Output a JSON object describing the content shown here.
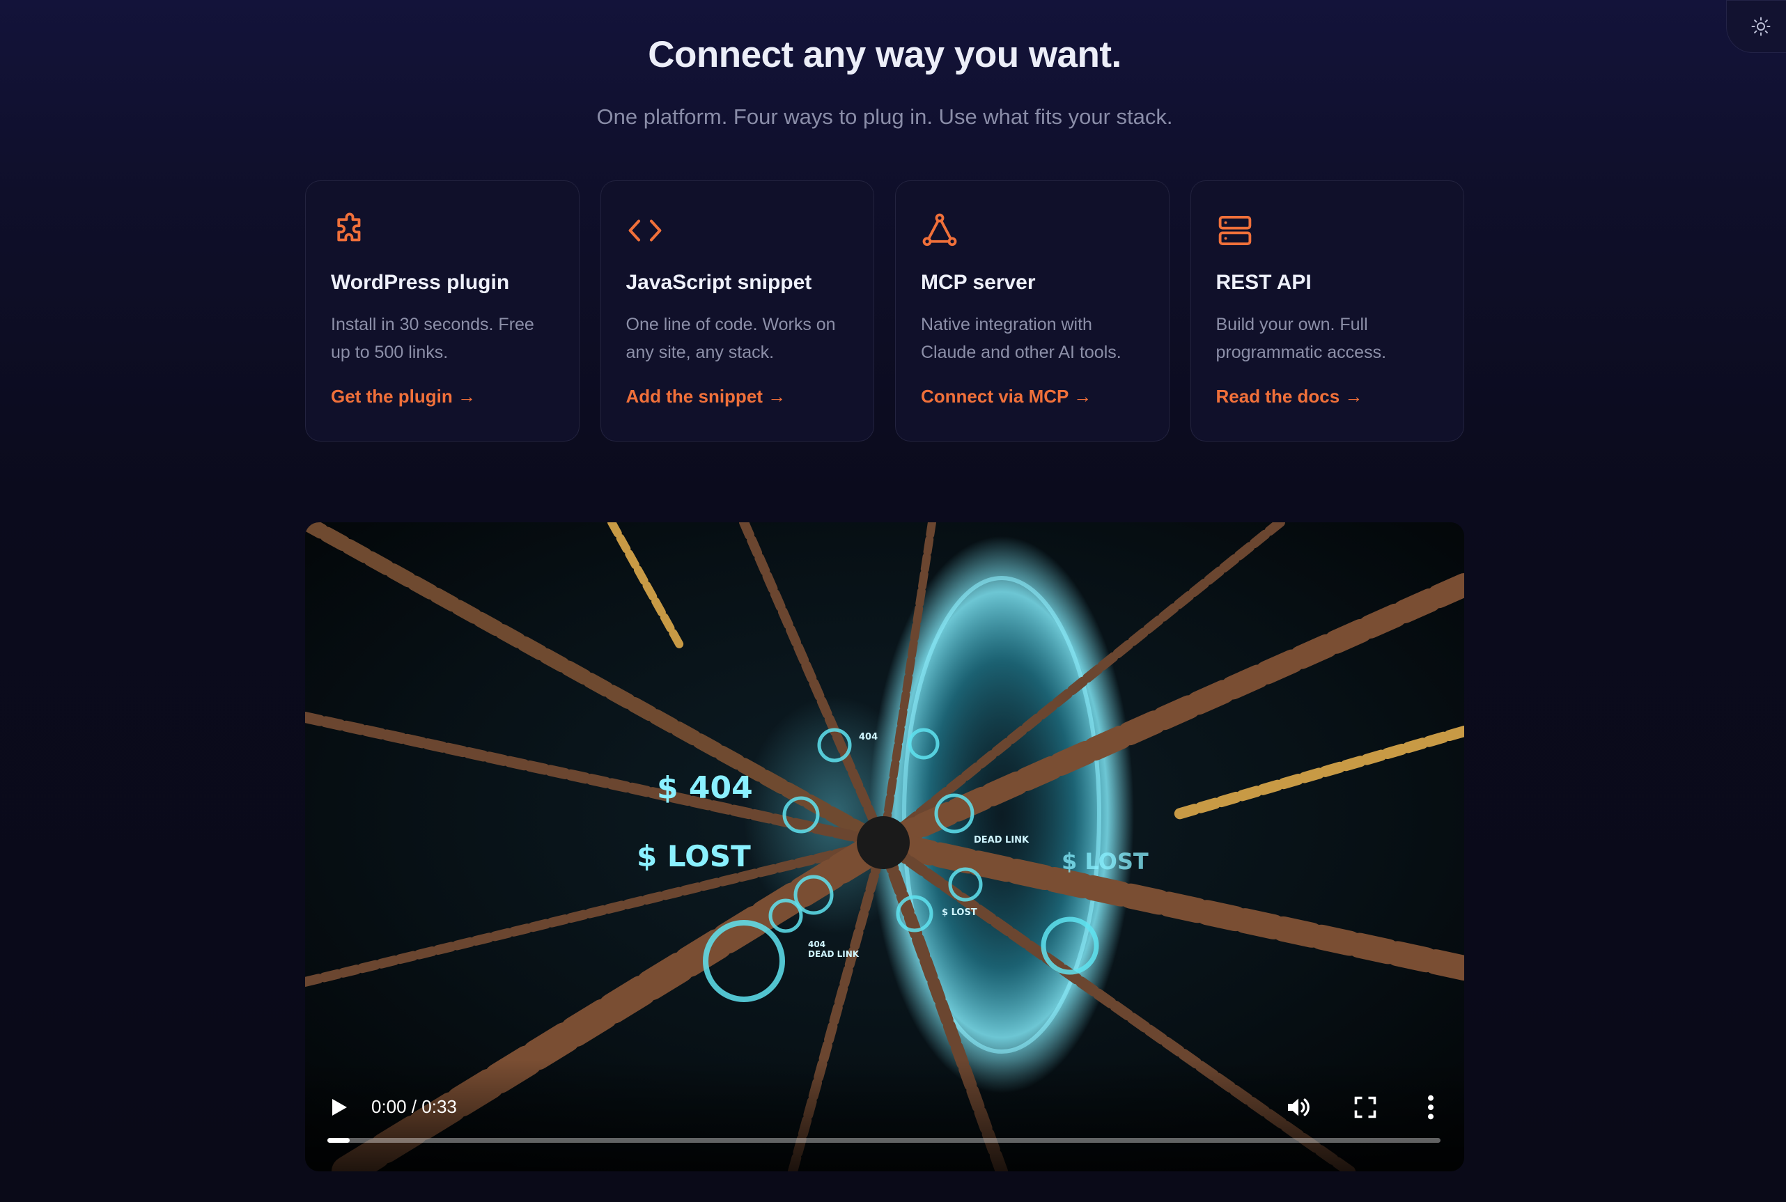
{
  "header": {
    "title": "Connect any way you want.",
    "subtitle": "One platform. Four ways to plug in. Use what fits your stack."
  },
  "theme_toggle": {
    "icon": "sun-icon"
  },
  "accent_color": "#f0703a",
  "cards": [
    {
      "icon": "puzzle-icon",
      "title": "WordPress plugin",
      "description": "Install in 30 seconds. Free up to 500 links.",
      "cta": "Get the plugin →"
    },
    {
      "icon": "code-brackets-icon",
      "title": "JavaScript snippet",
      "description": "One line of code. Works on any site, any stack.",
      "cta": "Add the snippet →"
    },
    {
      "icon": "network-triangle-icon",
      "title": "MCP server",
      "description": "Native integration with Claude and other AI tools.",
      "cta": "Connect via MCP →"
    },
    {
      "icon": "server-stack-icon",
      "title": "REST API",
      "description": "Build your own. Full programmatic access.",
      "cta": "Read the docs →"
    }
  ],
  "video": {
    "time_display": "0:00 / 0:33",
    "progress": 0.02,
    "overlay": {
      "big_404": "$ 404",
      "big_lost": "$ LOST",
      "right_lost": "$ LOST",
      "small_404": "404",
      "dead_link": "DEAD LINK",
      "small_lost": "$ LOST",
      "small_404_dead": "404",
      "small_dead_link": "DEAD LINK"
    }
  }
}
